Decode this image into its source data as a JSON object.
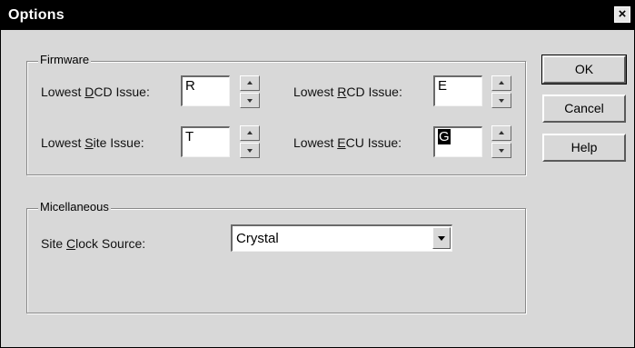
{
  "window": {
    "title": "Options",
    "close_glyph": "×"
  },
  "firmware": {
    "group_label": "Firmware",
    "fields": [
      {
        "label_pre": "Lowest ",
        "label_key": "D",
        "label_post": "CD Issue:",
        "value": "R"
      },
      {
        "label_pre": "Lowest ",
        "label_key": "R",
        "label_post": "CD Issue:",
        "value": "E"
      },
      {
        "label_pre": "Lowest ",
        "label_key": "S",
        "label_post": "ite Issue:",
        "value": "T"
      },
      {
        "label_pre": "Lowest ",
        "label_key": "E",
        "label_post": "CU Issue:",
        "value": "G"
      }
    ]
  },
  "misc": {
    "group_label": "Micellaneous",
    "clock_label_pre": "Site ",
    "clock_label_key": "C",
    "clock_label_post": "lock Source:",
    "clock_value": "Crystal"
  },
  "buttons": {
    "ok": "OK",
    "cancel": "Cancel",
    "help": "Help"
  },
  "icons": {
    "close": "close-icon",
    "spin_up": "spin-up-arrow-icon",
    "spin_down": "spin-down-arrow-icon",
    "dropdown": "chevron-down-icon"
  }
}
